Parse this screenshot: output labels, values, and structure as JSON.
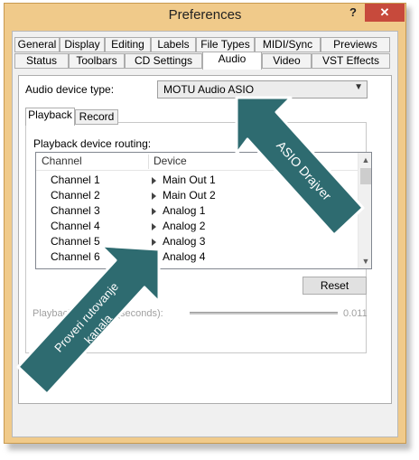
{
  "window": {
    "title": "Preferences",
    "help": "?",
    "close": "✕"
  },
  "tabs_row1": [
    "General",
    "Display",
    "Editing",
    "Labels",
    "File Types",
    "MIDI/Sync",
    "Previews"
  ],
  "tabs_row2": [
    "Status",
    "Toolbars",
    "CD Settings",
    "Audio",
    "Video",
    "VST Effects"
  ],
  "active_tab": "Audio",
  "audio": {
    "device_type_label": "Audio device type:",
    "device_type_value": "MOTU Audio ASIO",
    "subtabs": [
      "Playback",
      "Record"
    ],
    "routing_label": "Playback device routing:",
    "columns": [
      "Channel",
      "Device"
    ],
    "rows": [
      {
        "channel": "Channel 1",
        "device": "Main Out 1"
      },
      {
        "channel": "Channel 2",
        "device": "Main Out 2"
      },
      {
        "channel": "Channel 3",
        "device": "Analog 1"
      },
      {
        "channel": "Channel 4",
        "device": "Analog 2"
      },
      {
        "channel": "Channel 5",
        "device": "Analog 3"
      },
      {
        "channel": "Channel 6",
        "device": "Analog 4"
      }
    ],
    "reset_label": "Reset",
    "buffering_label": "Playback buffering (seconds):",
    "buffering_value": "0.011"
  },
  "annotations": {
    "asio": "ASIO Drajver",
    "routing_line1": "Proveri rutovanje",
    "routing_line2": "kanala"
  },
  "colors": {
    "titlebar": "#f0ca8a",
    "close": "#c74a3c",
    "arrow_fill": "#2e6b70",
    "arrow_stroke": "#ffffff"
  }
}
